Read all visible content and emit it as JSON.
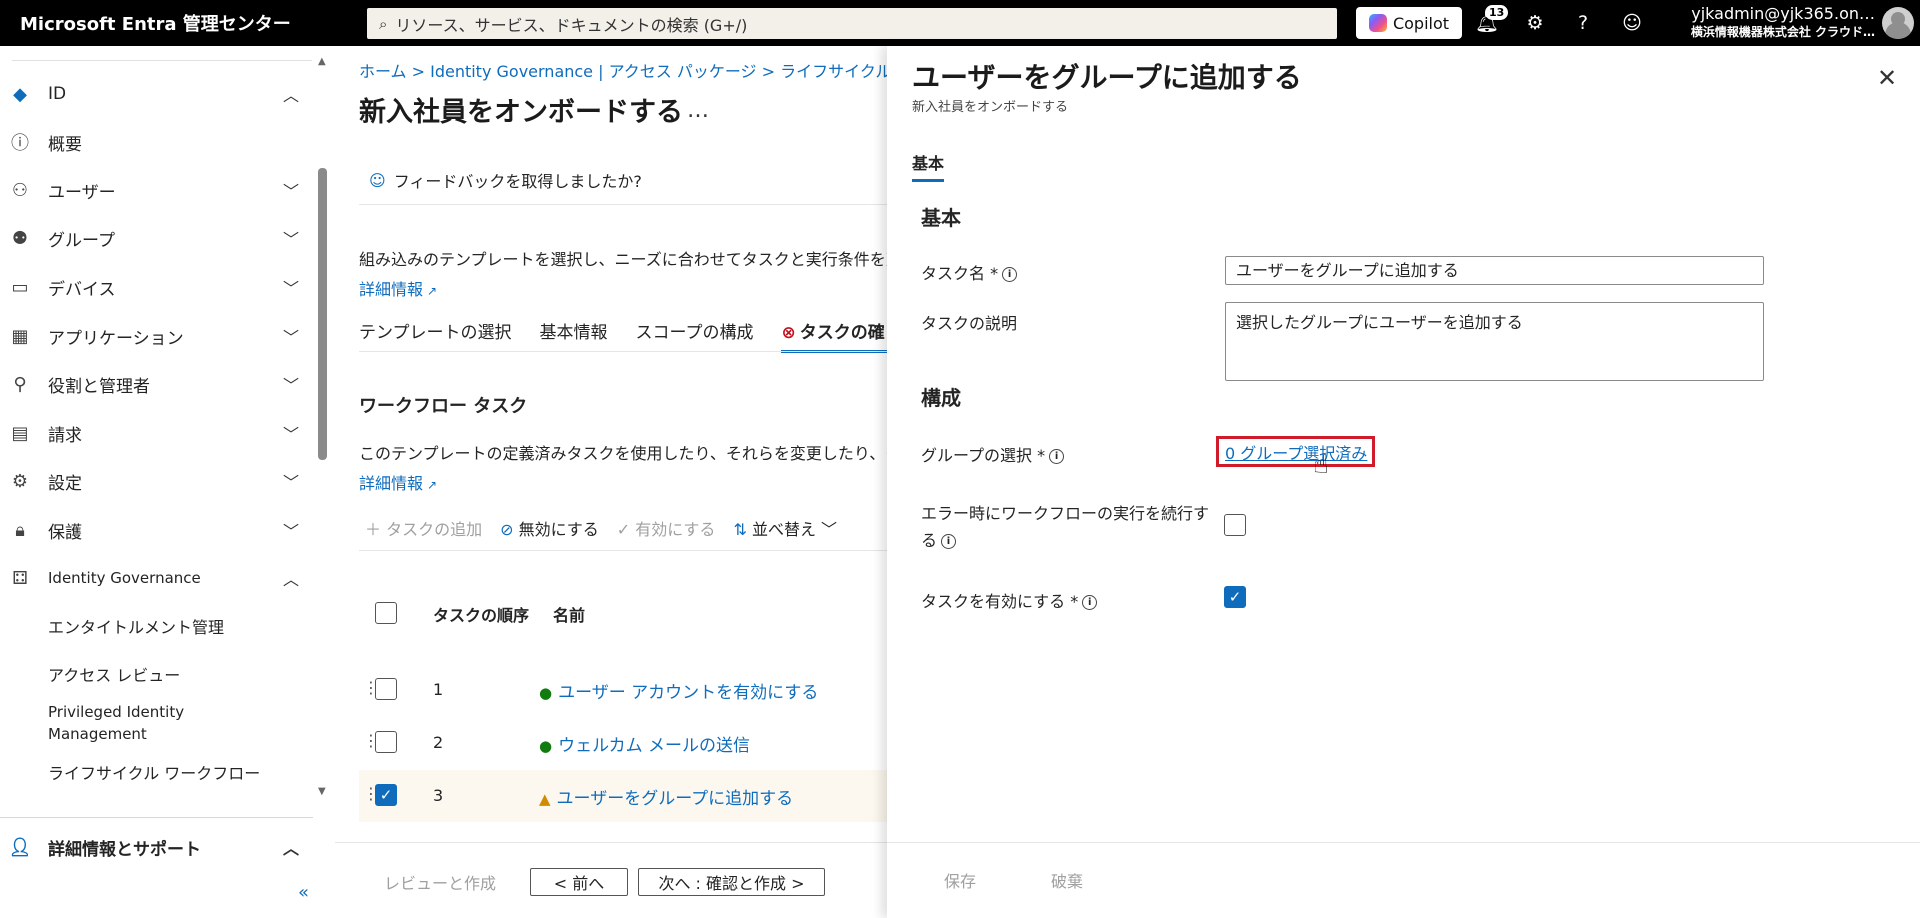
{
  "topbar": {
    "brand": "Microsoft Entra 管理センター",
    "search_placeholder": "リソース、サービス、ドキュメントの検索 (G+/)",
    "copilot_label": "Copilot",
    "notification_count": "13",
    "account_user": "yjkadmin@yjk365.on…",
    "account_org": "横浜情報機器株式会社 クラウド…"
  },
  "sidebar": {
    "items": [
      {
        "icon": "id-diamond-icon",
        "label": "ID",
        "chevron": "up"
      },
      {
        "icon": "info-icon",
        "label": "概要"
      },
      {
        "icon": "user-icon",
        "label": "ユーザー",
        "chevron": "down"
      },
      {
        "icon": "group-icon",
        "label": "グループ",
        "chevron": "down"
      },
      {
        "icon": "device-icon",
        "label": "デバイス",
        "chevron": "down"
      },
      {
        "icon": "apps-icon",
        "label": "アプリケーション",
        "chevron": "down"
      },
      {
        "icon": "roles-icon",
        "label": "役割と管理者",
        "chevron": "down"
      },
      {
        "icon": "billing-icon",
        "label": "請求",
        "chevron": "down"
      },
      {
        "icon": "settings-icon",
        "label": "設定",
        "chevron": "down"
      },
      {
        "icon": "lock-icon",
        "label": "保護",
        "chevron": "down"
      },
      {
        "icon": "governance-icon",
        "label": "Identity Governance",
        "chevron": "up"
      }
    ],
    "sub_items": [
      "エンタイトルメント管理",
      "アクセス レビュー",
      "Privileged Identity",
      "Management",
      "ライフサイクル ワークフロー"
    ],
    "support_label": "詳細情報とサポート",
    "collapse_glyph": "«"
  },
  "main": {
    "breadcrumb": "ホーム  >  Identity Governance | アクセス パッケージ  >  ライフサイクル ワーク",
    "title": "新入社員をオンボードする",
    "more": "…",
    "feedback": "フィードバックを取得しましたか?",
    "description": "組み込みのテンプレートを選択し、ニーズに合わせてタスクと実行条件を変",
    "learn_more": "詳細情報",
    "tabs": [
      "テンプレートの選択",
      "基本情報",
      "スコープの構成",
      "タスクの確"
    ],
    "section_title": "ワークフロー タスク",
    "section_desc": "このテンプレートの定義済みタスクを使用したり、それらを変更したり、タ",
    "section_learn_more": "詳細情報",
    "toolbar": {
      "add_task": "＋ タスクの追加",
      "disable": "無効にする",
      "enable": "有効にする",
      "reorder": "並べ替え"
    },
    "table": {
      "headers": [
        "タスクの順序",
        "名前"
      ],
      "rows": [
        {
          "order": "1",
          "name": "ユーザー アカウントを有効にする",
          "status": "ok",
          "checked": false
        },
        {
          "order": "2",
          "name": "ウェルカム メールの送信",
          "status": "ok",
          "checked": false
        },
        {
          "order": "3",
          "name": "ユーザーをグループに追加する",
          "status": "warning",
          "checked": true
        }
      ]
    },
    "footer": {
      "review_create": "レビューと作成",
      "prev": "< 前へ",
      "next": "次へ : 確認と作成 >"
    }
  },
  "panel": {
    "title": "ユーザーをグループに追加する",
    "subtitle": "新入社員をオンボードする",
    "tab": "基本",
    "basics_heading": "基本",
    "task_name_label": "タスク名 *",
    "task_name_value": "ユーザーをグループに追加する",
    "task_desc_label": "タスクの説明",
    "task_desc_value": "選択したグループにユーザーを追加する",
    "config_heading": "構成",
    "group_select_label": "グループの選択 *",
    "group_select_link": "0 グループ選択済み",
    "continue_on_error_label_1": "エラー時にワークフローの実行を続行す",
    "continue_on_error_label_2": "る",
    "continue_on_error_checked": false,
    "enable_task_label": "タスクを有効にする *",
    "enable_task_checked": true,
    "save": "保存",
    "discard": "破棄"
  },
  "colors": {
    "accent": "#0f6cbd",
    "highlight_box": "#d01c2a",
    "topbar": "#000000"
  }
}
